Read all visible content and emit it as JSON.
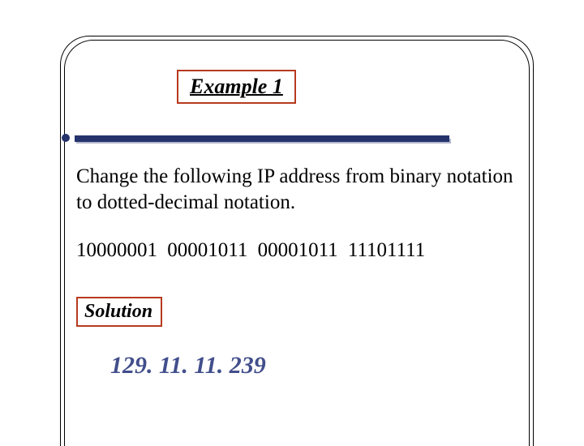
{
  "title": "Example 1",
  "problem": "Change the following IP address from binary notation to dotted-decimal notation.",
  "binary": "10000001  00001011   00001011 11101111",
  "solution_label": "Solution",
  "answer": "129. 11. 11. 239"
}
